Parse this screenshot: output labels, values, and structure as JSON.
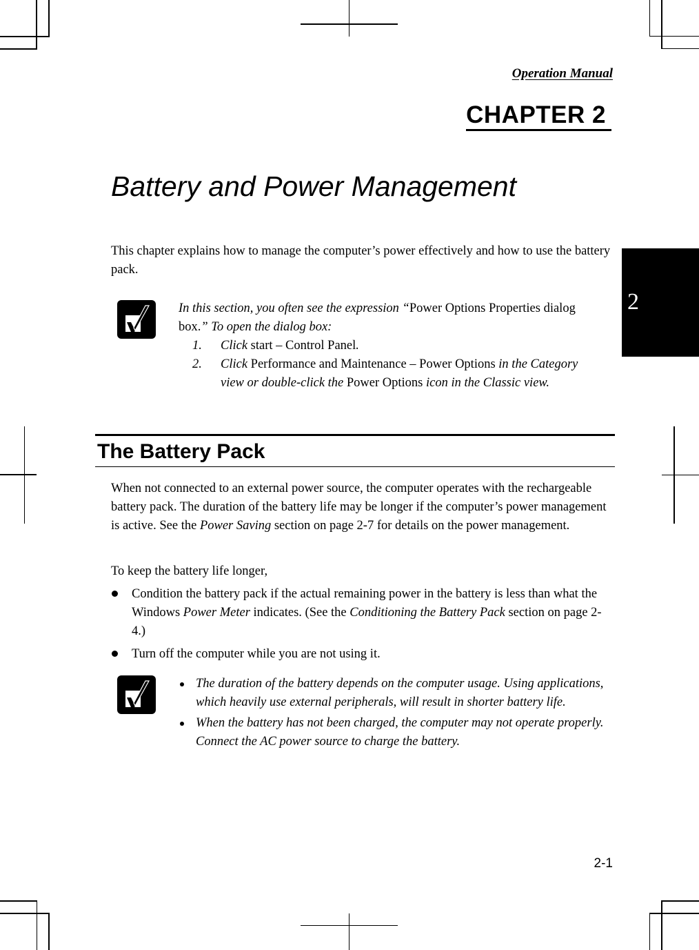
{
  "header": {
    "running_title": "Operation Manual",
    "chapter_label": "CHAPTER 2"
  },
  "chapter": {
    "title": "Battery and Power Management",
    "intro": "This chapter explains how to manage the computer’s power effectively and how to use the battery pack."
  },
  "note1": {
    "icon": "checkmark-note-icon",
    "line1_italic": "In this section, you often see the expression “",
    "line1_normal": "Power Options Properties dialog box.",
    "line1_italic_end": "” To open the dialog box:",
    "steps": [
      {
        "num": "1.",
        "parts": [
          {
            "text": "Click ",
            "italic": true
          },
          {
            "text": "start – Control Panel",
            "italic": false
          },
          {
            "text": ".",
            "italic": true
          }
        ]
      },
      {
        "num": "2.",
        "parts": [
          {
            "text": "Click ",
            "italic": true
          },
          {
            "text": "Performance and Maintenance – Power Options ",
            "italic": false
          },
          {
            "text": "in the Category view or double-click the ",
            "italic": true
          },
          {
            "text": "Power Options ",
            "italic": false
          },
          {
            "text": "icon in the Classic view.",
            "italic": true
          }
        ]
      }
    ]
  },
  "section": {
    "title": "The Battery Pack",
    "para1_a": "When not connected to an external power source, the computer operates with the rechargeable battery pack. The duration of the battery life may be longer if the computer’s power management is active. See the ",
    "para1_link": "Power Saving",
    "para1_b": " section on page 2-7 for details on the power management.",
    "para2": "To keep the battery life longer,",
    "bullets": [
      {
        "parts": [
          {
            "text": "Condition the battery pack if the actual remaining power in the battery is less than what the Windows ",
            "italic": false
          },
          {
            "text": "Power Meter",
            "italic": true
          },
          {
            "text": " indicates. (See the ",
            "italic": false
          },
          {
            "text": "Conditioning the Battery Pack",
            "italic": true
          },
          {
            "text": " section on page 2-4.)",
            "italic": false
          }
        ]
      },
      {
        "parts": [
          {
            "text": "Turn off the computer while you are not using it.",
            "italic": false
          }
        ]
      }
    ]
  },
  "note2": {
    "icon": "checkmark-note-icon",
    "items": [
      "The duration of the battery depends on the computer usage. Using applications, which heavily use external peripherals, will result in shorter battery life.",
      "When the battery has not been charged, the computer may not operate properly. Connect the AC power source to charge the battery."
    ]
  },
  "tab": {
    "chapter_number": "2",
    "background": "#000000",
    "text_color": "#ffffff"
  },
  "footer": {
    "page_number": "2-1"
  }
}
